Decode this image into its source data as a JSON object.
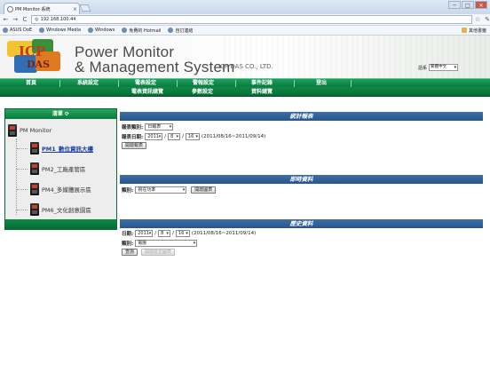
{
  "browser": {
    "tab_title": "PM Monitor 系統",
    "url": "192.168.100.44",
    "bookmarks": [
      "ASUS DoE",
      "Windows Media",
      "Windows",
      "免費的 Hotmail",
      "自訂連結"
    ],
    "other_bookmarks": "其他書籤",
    "win_min": "─",
    "win_max": "□",
    "win_close": "✕",
    "nav_back": "←",
    "nav_forward": "→",
    "nav_reload": "C",
    "star": "☆",
    "wrench": "✎"
  },
  "header": {
    "logo_text_1": "ICP",
    "logo_text_2": "DAS",
    "title_line1": "Power Monitor",
    "title_line2": "& Management System",
    "company": "ICP DAS CO., LTD.",
    "language_label": "語系",
    "language_value": "繁體中文"
  },
  "menu": {
    "row1": [
      "首頁",
      "系統設定",
      "電表設定",
      "警報設定",
      "事件記錄",
      "登出"
    ],
    "row2": [
      "電表資訊總覽",
      "參數設定",
      "資料總覽"
    ]
  },
  "sidebar": {
    "title": "清單",
    "root": "PM Monitor",
    "items": [
      {
        "label": "PM1_數位資訊大樓",
        "active": true
      },
      {
        "label": "PM2_工廠產管區",
        "active": false
      },
      {
        "label": "PM4_多媒體展示區",
        "active": false
      },
      {
        "label": "PM6_文化創意園區",
        "active": false
      }
    ]
  },
  "report": {
    "title": "統計報表",
    "type_label": "報表類別:",
    "type_value": "日報表",
    "date_label": "報表日期:",
    "year": "2011",
    "month": "8",
    "day": "16",
    "range": "(2011/08/16~2011/09/14)",
    "open_button": "開啟報表"
  },
  "realtime": {
    "title": "即時資料",
    "type_label": "類別:",
    "type_value": "視在功率",
    "open_button": "開啟圖表"
  },
  "history": {
    "title": "歷史資料",
    "date_label": "日期:",
    "year": "2011",
    "month": "8",
    "day": "16",
    "range": "(2011/08/16~2011/09/14)",
    "type_label": "類別:",
    "type_value": "電壓",
    "query_button": "查詢",
    "open_button": "開啟歷史圖表"
  },
  "colors": {
    "menu_green": "#0b7a3f",
    "panel_blue": "#27558f",
    "active_link": "#1a3fa3"
  }
}
